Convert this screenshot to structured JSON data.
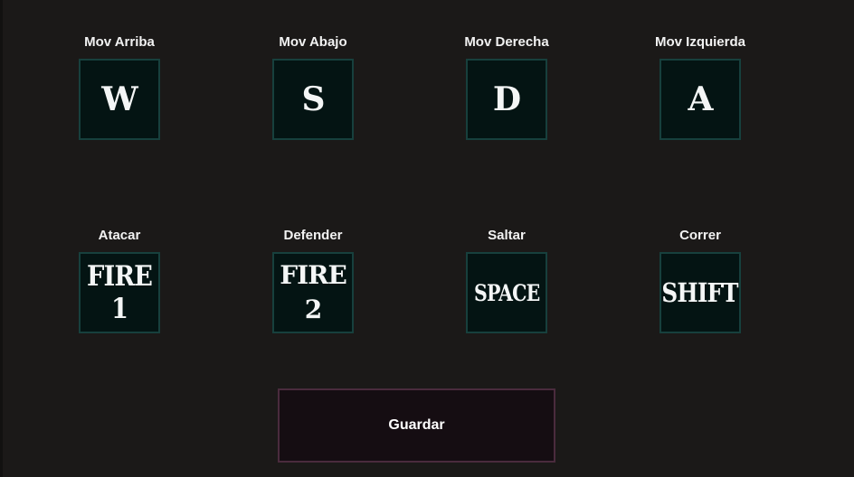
{
  "bindings_row1": [
    {
      "action": "Mov Arriba",
      "key": "W"
    },
    {
      "action": "Mov Abajo",
      "key": "S"
    },
    {
      "action": "Mov Derecha",
      "key": "D"
    },
    {
      "action": "Mov Izquierda",
      "key": "A"
    }
  ],
  "bindings_row2": [
    {
      "action": "Atacar",
      "key": "FIRE 1"
    },
    {
      "action": "Defender",
      "key": "FIRE\n2"
    },
    {
      "action": "Saltar",
      "key": "SPACE"
    },
    {
      "action": "Correr",
      "key": "SHIFT"
    }
  ],
  "save_label": "Guardar",
  "colors": {
    "background": "#1b1918",
    "key_fill": "#041413",
    "key_border": "#17403d",
    "button_fill": "#150d12",
    "button_border": "#4a2b3d",
    "text": "#f2f2f2"
  }
}
